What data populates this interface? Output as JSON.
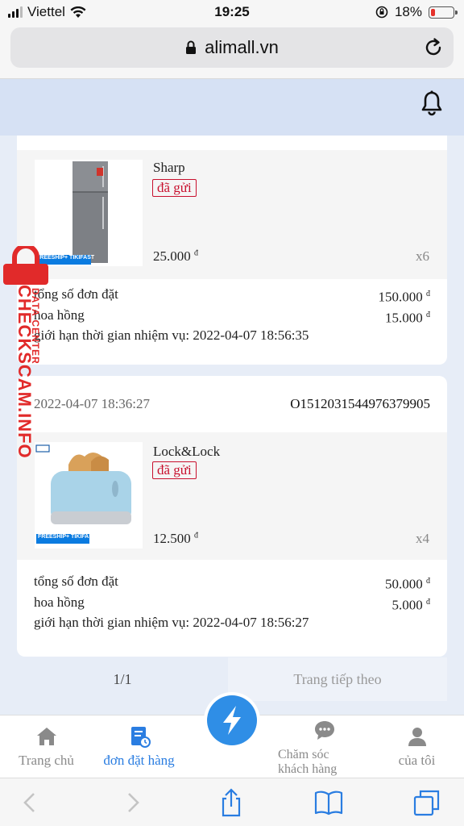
{
  "status_bar": {
    "carrier": "Viettel",
    "time": "19:25",
    "battery": "18%",
    "battery_level": 0.18
  },
  "browser": {
    "url": "alimall.vn"
  },
  "orders": [
    {
      "brand": "Sharp",
      "status": "đã gửi",
      "price": "25.000",
      "currency": "đ",
      "qty": "x6",
      "thumb_badge": "FREESHIP+ TIKIFAST",
      "total_label": "tổng số đơn đặt",
      "total_value": "150.000",
      "commission_label": "hoa hồng",
      "commission_value": "15.000",
      "deadline": "giới hạn thời gian nhiệm vụ: 2022-04-07 18:56:35"
    },
    {
      "date": "2022-04-07 18:36:27",
      "code": "O1512031544976379905",
      "brand": "Lock&Lock",
      "status": "đã gửi",
      "price": "12.500",
      "currency": "đ",
      "qty": "x4",
      "thumb_badge": "FREESHIP+ TIKIFAST",
      "total_label": "tổng số đơn đặt",
      "total_value": "50.000",
      "commission_label": "hoa hồng",
      "commission_value": "5.000",
      "deadline": "giới hạn thời gian nhiệm vụ: 2022-04-07 18:56:27"
    }
  ],
  "pager": {
    "page": "1/1",
    "next": "Trang tiếp theo"
  },
  "tabs": [
    {
      "label": "Trang chủ",
      "icon": "home-icon"
    },
    {
      "label": "đơn đặt hàng",
      "icon": "orders-icon"
    },
    {
      "label": "Chăm sóc khách hàng",
      "icon": "chat-icon"
    },
    {
      "label": "của tôi",
      "icon": "user-icon"
    }
  ],
  "watermark": {
    "main": "CHECKSCAM.INFO",
    "sub": "DATA CENTER"
  },
  "colors": {
    "accent": "#2a7de1",
    "status_red": "#c8102e",
    "header_bg": "#d6e1f4"
  }
}
